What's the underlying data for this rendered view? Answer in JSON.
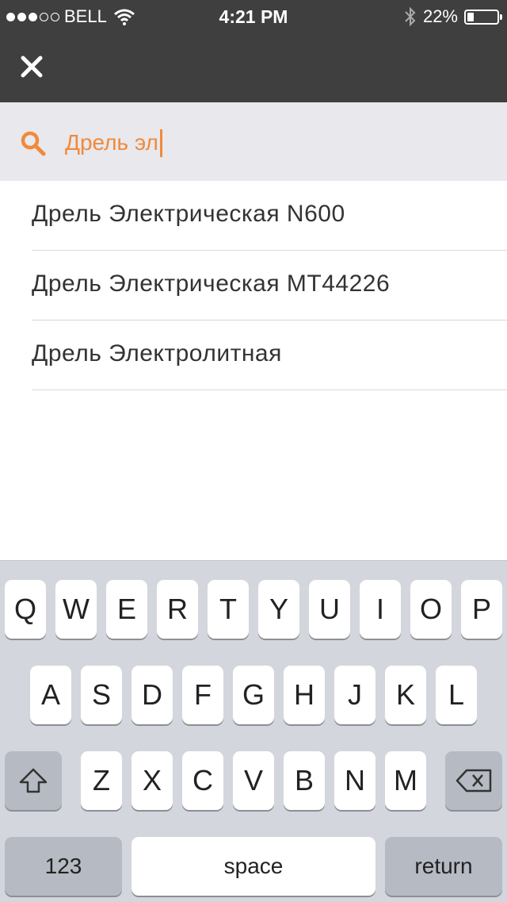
{
  "status_bar": {
    "carrier": "BELL",
    "time": "4:21 PM",
    "battery_percent": "22%",
    "battery_level": 0.22,
    "signal_bars_filled": 3,
    "signal_bars_total": 5,
    "icons": [
      "wifi-icon",
      "bluetooth-icon",
      "battery-icon"
    ]
  },
  "header": {
    "close_icon": "close-icon"
  },
  "search": {
    "value": "Дрель эл",
    "icon": "search-icon",
    "accent_color": "#f08a3c"
  },
  "results": [
    {
      "label": "Дрель Электрическая N600"
    },
    {
      "label": "Дрель Электрическая MT44226"
    },
    {
      "label": "Дрель Электролитная"
    }
  ],
  "keyboard": {
    "row1": [
      "Q",
      "W",
      "E",
      "R",
      "T",
      "Y",
      "U",
      "I",
      "O",
      "P"
    ],
    "row2": [
      "A",
      "S",
      "D",
      "F",
      "G",
      "H",
      "J",
      "K",
      "L"
    ],
    "row3": [
      "Z",
      "X",
      "C",
      "V",
      "B",
      "N",
      "M"
    ],
    "numbers_label": "123",
    "space_label": "space",
    "return_label": "return"
  },
  "colors": {
    "header_bg": "#3f3f3f",
    "search_bg": "#e8e8ed",
    "accent": "#f08a3c",
    "keyboard_bg": "#d3d6dc"
  }
}
